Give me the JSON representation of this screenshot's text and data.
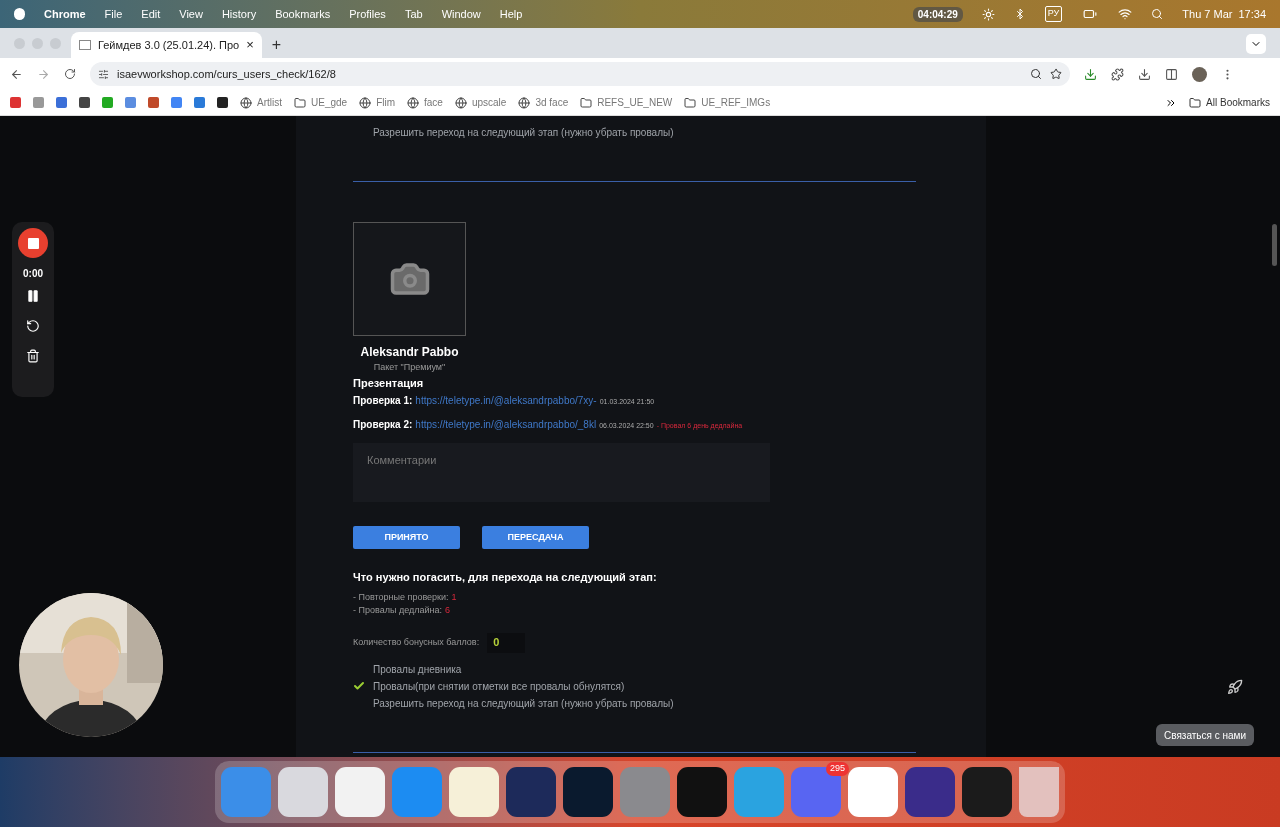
{
  "menu_bar": {
    "app": "Chrome",
    "items": [
      "File",
      "Edit",
      "View",
      "History",
      "Bookmarks",
      "Profiles",
      "Tab",
      "Window",
      "Help"
    ],
    "timer": "04:04:29",
    "input_source": "РУ",
    "date": "Thu 7 Mar",
    "time": "17:34"
  },
  "tab": {
    "title": "Геймдев 3.0 (25.01.24). Про",
    "close": "×",
    "new_tab": "+"
  },
  "address_bar": {
    "url": "isaevworkshop.com/curs_users_check/162/8"
  },
  "bookmarks": [
    {
      "kind": "site",
      "label": "Artlist"
    },
    {
      "kind": "folder",
      "label": "UE_gde"
    },
    {
      "kind": "site",
      "label": "Flim"
    },
    {
      "kind": "site",
      "label": "face"
    },
    {
      "kind": "site",
      "label": "upscale"
    },
    {
      "kind": "site",
      "label": "3d face"
    },
    {
      "kind": "folder",
      "label": "REFS_UE_NEW"
    },
    {
      "kind": "folder",
      "label": "UE_REF_IMGs"
    }
  ],
  "all_bookmarks": "All Bookmarks",
  "recorder": {
    "elapsed": "0:00"
  },
  "previous_options": [
    {
      "label": "Разрешить переход на следующий этап (нужно убрать провалы)",
      "checked": false
    }
  ],
  "student": {
    "name": "Aleksandr Pabbo",
    "package": "Пакет \"Премиум\""
  },
  "assignment": {
    "title": "Презентация",
    "checks": [
      {
        "label": "Проверка 1:",
        "link": "https://teletype.in/@aleksandrpabbo/7xy-",
        "date": "01.03.2024 21:50"
      },
      {
        "label": "Проверка 2:",
        "link": "https://teletype.in/@aleksandrpabbo/_8kl",
        "date": "06.03.2024 22:50",
        "note": "- Провал 6 день дедлайна"
      }
    ]
  },
  "comment": {
    "placeholder": "Комментарии"
  },
  "buttons": [
    "ПРИНЯТО",
    "ПЕРЕСДАЧА"
  ],
  "requirements": {
    "title": "Что нужно погасить, для перехода на следующий этап:",
    "items": [
      {
        "label": "- Повторные проверки:",
        "value": "1"
      },
      {
        "label": "- Провалы дедлайна:",
        "value": "6"
      }
    ]
  },
  "bonus": {
    "label": "Количество бонусных баллов:",
    "value": "0"
  },
  "options": [
    {
      "label": "Провалы дневника",
      "checked": false
    },
    {
      "label": "Провалы(при снятии отметки все провалы обнулятся)",
      "checked": true
    },
    {
      "label": "Разрешить переход на следующий этап (нужно убрать провалы)",
      "checked": false
    }
  ],
  "contact_button": "Связаться с нами",
  "dock": {
    "apps": [
      {
        "color": "#3b8ee8"
      },
      {
        "color": "#d9d9de"
      },
      {
        "color": "#f2f2f2"
      },
      {
        "color": "#1c8cf2"
      },
      {
        "color": "#f6f0d8"
      },
      {
        "color": "#1d2a5a"
      },
      {
        "color": "#0a1a2e"
      },
      {
        "color": "#8a8a8e"
      },
      {
        "color": "#111111"
      },
      {
        "color": "#2aa3e0"
      },
      {
        "color": "#5865f2"
      },
      {
        "color": "#ffffff"
      },
      {
        "color": "#3a2c8a"
      },
      {
        "color": "#1b1b1b"
      }
    ],
    "badge": "295"
  }
}
